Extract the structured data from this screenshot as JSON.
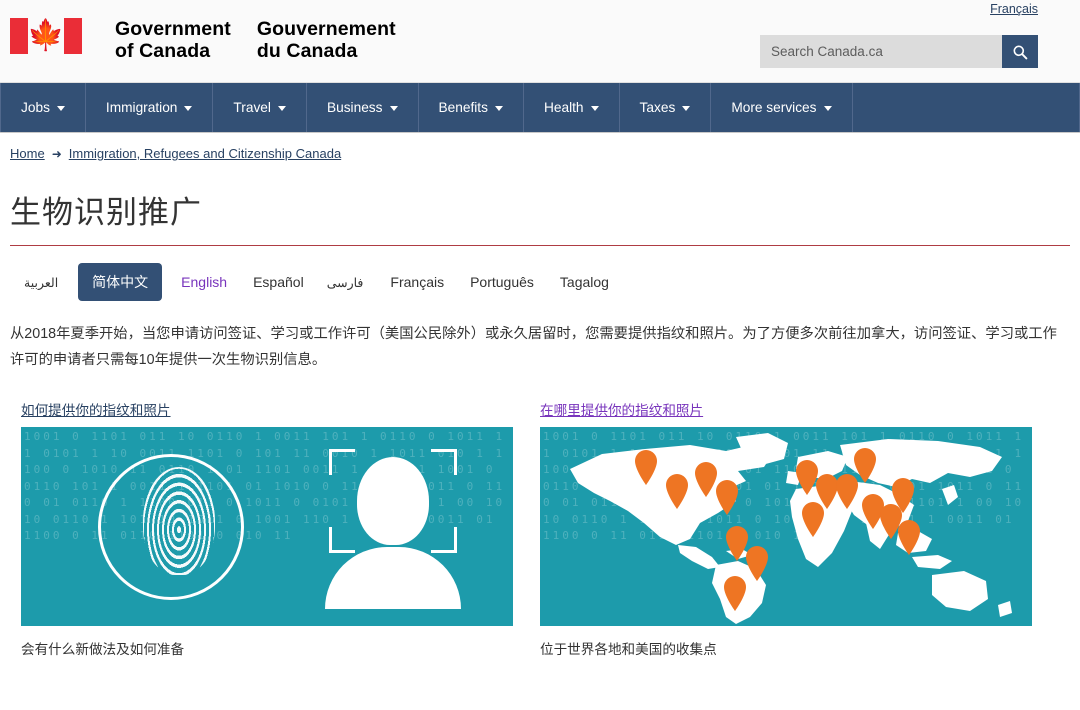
{
  "header": {
    "lang_toggle": "Français",
    "wordmark_en_line1": "Government",
    "wordmark_en_line2": "of Canada",
    "wordmark_fr_line1": "Gouvernement",
    "wordmark_fr_line2": "du Canada",
    "flag_leaf": "maple-leaf",
    "search": {
      "placeholder": "Search Canada.ca",
      "value": "",
      "button_icon": "search-icon"
    }
  },
  "nav": {
    "items": [
      {
        "label": "Jobs"
      },
      {
        "label": "Immigration"
      },
      {
        "label": "Travel"
      },
      {
        "label": "Business"
      },
      {
        "label": "Benefits"
      },
      {
        "label": "Health"
      },
      {
        "label": "Taxes"
      },
      {
        "label": "More services"
      }
    ]
  },
  "breadcrumb": {
    "home": "Home",
    "arrow": "➜",
    "current": "Immigration, Refugees and Citizenship Canada"
  },
  "page": {
    "title": "生物识别推广",
    "body": "从2018年夏季开始，当您申请访问签证、学习或工作许可（美国公民除外）或永久居留时，您需要提供指纹和照片。为了方便多次前往加拿大，访问签证、学习或工作许可的申请者只需每10年提供一次生物识别信息。"
  },
  "language_tabs": [
    {
      "label": "العربية",
      "state": "rtl"
    },
    {
      "label": "简体中文",
      "state": "active"
    },
    {
      "label": "English",
      "state": "visited"
    },
    {
      "label": "Español",
      "state": "normal"
    },
    {
      "label": "فارسی",
      "state": "rtl"
    },
    {
      "label": "Français",
      "state": "normal"
    },
    {
      "label": "Português",
      "state": "normal"
    },
    {
      "label": "Tagalog",
      "state": "normal"
    }
  ],
  "cards": [
    {
      "link": "如何提供你的指纹和照片",
      "link_state": "normal",
      "caption": "会有什么新做法及如何准备",
      "figure": "fingerprint-face-biometrics-image"
    },
    {
      "link": "在哪里提供你的指纹和照片",
      "link_state": "visited",
      "caption": "位于世界各地和美国的收集点",
      "figure": "world-map-collection-points-image"
    }
  ],
  "colors": {
    "nav_blue": "#335075",
    "link_blue": "#284162",
    "visited_purple": "#7834bc",
    "flag_red": "#ea2d37",
    "title_rule_red": "#af3c43",
    "image_teal": "#1d9bab",
    "pin_orange": "#ee7523"
  },
  "binary_texture": "1001 0 1101 011 10 0110 1 0011 101 1 0110 0 1011 11 0101 1 10 0011 1101 0 101 11 0010 1 1011 010 1 1100 0 1010 11 0110 1 01 1101 0011 1 010 11 1001 0 0110 101 1 0011 1 1101 01 1010 0 11 0101 1011 0 110 01 0110 1 1100 011 0 1011 0 0101 10 1101 1 00 1010 0110 1 101 10 1011 0 1001 110 1 0101 1 0011 01 1100 0 11 0110 1101 0 010 11"
}
